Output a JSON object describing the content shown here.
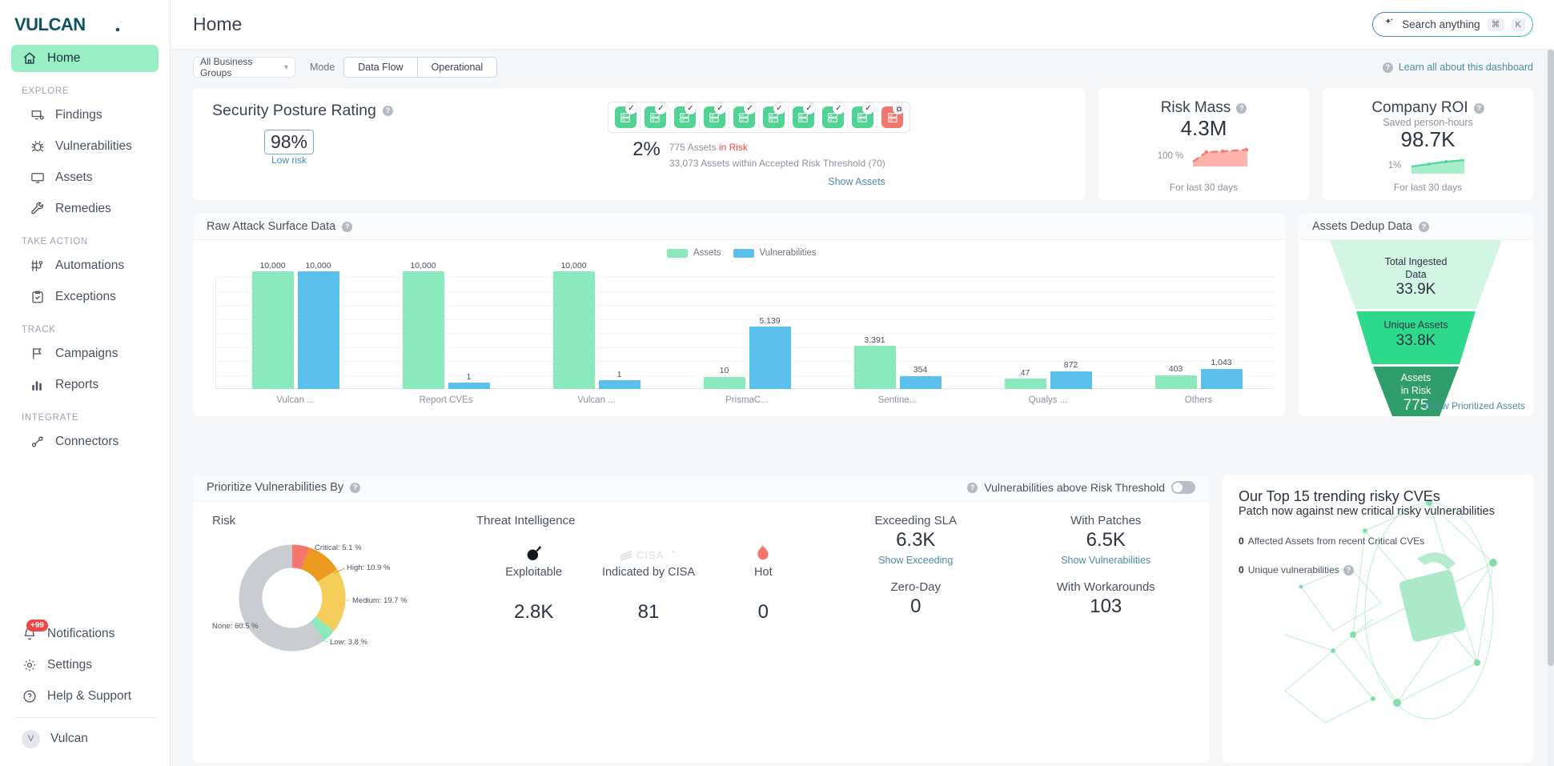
{
  "sidebar": {
    "logo_text": "VULCAN.",
    "home": {
      "label": "Home",
      "icon": "home-icon"
    },
    "sections": [
      {
        "title": "EXPLORE",
        "items": [
          {
            "label": "Findings",
            "icon": "findings-icon"
          },
          {
            "label": "Vulnerabilities",
            "icon": "bug-icon"
          },
          {
            "label": "Assets",
            "icon": "monitor-icon"
          },
          {
            "label": "Remedies",
            "icon": "wrench-icon"
          }
        ]
      },
      {
        "title": "TAKE ACTION",
        "items": [
          {
            "label": "Automations",
            "icon": "automations-icon"
          },
          {
            "label": "Exceptions",
            "icon": "clipboard-check-icon"
          }
        ]
      },
      {
        "title": "TRACK",
        "items": [
          {
            "label": "Campaigns",
            "icon": "flag-icon"
          },
          {
            "label": "Reports",
            "icon": "bar-chart-icon"
          }
        ]
      },
      {
        "title": "INTEGRATE",
        "items": [
          {
            "label": "Connectors",
            "icon": "connectors-icon"
          }
        ]
      }
    ],
    "bottom": [
      {
        "label": "Notifications",
        "icon": "bell-icon",
        "badge": "+99"
      },
      {
        "label": "Settings",
        "icon": "gear-icon"
      },
      {
        "label": "Help & Support",
        "icon": "help-circle-icon"
      }
    ],
    "account": {
      "label": "Vulcan",
      "initial": "V"
    }
  },
  "header": {
    "title": "Home",
    "search": {
      "placeholder": "Search anything",
      "kbd1": "⌘",
      "kbd2": "K",
      "icon": "sparkle-icon"
    }
  },
  "filters": {
    "business_group": "All Business Groups",
    "mode_label": "Mode",
    "mode_options": [
      "Data Flow",
      "Operational"
    ],
    "learn_link": "Learn all about this dashboard"
  },
  "security_posture": {
    "title": "Security Posture Rating",
    "rating": "98%",
    "risk_label": "Low risk",
    "at_risk_pct": "2%",
    "assets_in_risk_prefix": "775 Assets ",
    "assets_in_risk_suffix": "in Risk",
    "within_threshold": "33,073 Assets within Accepted Risk Threshold (70)",
    "show_assets": "Show Assets",
    "servers": [
      {
        "state": "ok"
      },
      {
        "state": "ok"
      },
      {
        "state": "ok"
      },
      {
        "state": "ok"
      },
      {
        "state": "ok"
      },
      {
        "state": "ok"
      },
      {
        "state": "ok"
      },
      {
        "state": "ok"
      },
      {
        "state": "ok"
      },
      {
        "state": "risk"
      }
    ]
  },
  "risk_mass": {
    "title": "Risk Mass",
    "value": "4.3M",
    "delta": "100 %",
    "footer": "For last 30 days",
    "color": "#f4776e"
  },
  "company_roi": {
    "title": "Company ROI",
    "subtitle": "Saved person-hours",
    "value": "98.7K",
    "delta": "1%",
    "footer": "For last 30 days",
    "color": "#8ae9bd"
  },
  "raw_attack_surface": {
    "title": "Raw Attack Surface Data"
  },
  "chart_data": {
    "type": "bar",
    "title": "Raw Attack Surface Data",
    "categories": [
      "Vulcan ...",
      "Report CVEs",
      "Vulcan ...",
      "PrismaC...",
      "Sentine...",
      "Qualys ...",
      "Others"
    ],
    "series": [
      {
        "name": "Assets",
        "color": "#8ae9bd",
        "values": [
          10000,
          10000,
          10000,
          10,
          3391,
          47,
          403
        ],
        "labels": [
          "10,000",
          "10,000",
          "10,000",
          "10",
          "3,391",
          "47",
          "403"
        ]
      },
      {
        "name": "Vulnerabilities",
        "color": "#5bc0ec",
        "values": [
          10000,
          1,
          1,
          5139,
          354,
          872,
          1043
        ],
        "labels": [
          "10,000",
          "1",
          "1",
          "5,139",
          "354",
          "872",
          "1,043"
        ]
      }
    ],
    "ylim": [
      0,
      10000
    ],
    "grid": true,
    "legend_position": "top-center",
    "xlabel": "",
    "ylabel": ""
  },
  "assets_dedup": {
    "title": "Assets Dedup Data",
    "show_link": "Show Prioritized Assets",
    "stages": [
      {
        "name": "Total Ingested\nData",
        "name_l1": "Total Ingested",
        "name_l2": "Data",
        "value": "33.9K",
        "color": "#d3f5e4"
      },
      {
        "name": "Unique Assets",
        "name_l1": "Unique Assets",
        "name_l2": "",
        "value": "33.8K",
        "color": "#2ed98b"
      },
      {
        "name": "Assets in Risk",
        "name_l1": "Assets",
        "name_l2": "in Risk",
        "value": "775",
        "color": "#2f9e6b"
      }
    ]
  },
  "prioritize": {
    "title": "Prioritize Vulnerabilities By",
    "threshold_toggle_label": "Vulnerabilities above Risk Threshold",
    "risk": {
      "heading": "Risk",
      "slices": [
        {
          "label": "Critical: 5.1 %",
          "value": 5.1,
          "color": "#f4776e"
        },
        {
          "label": "High: 10.9 %",
          "value": 10.9,
          "color": "#eb9a1e"
        },
        {
          "label": "Medium: 19.7 %",
          "value": 19.7,
          "color": "#f5ce5a"
        },
        {
          "label": "Low: 3.8 %",
          "value": 3.8,
          "color": "#8ae9bd"
        },
        {
          "label": "None: 60.5 %",
          "value": 60.5,
          "color": "#c9ccd1"
        }
      ]
    },
    "threat_intelligence": {
      "heading": "Threat Intelligence",
      "items": [
        {
          "name": "Exploitable",
          "value": "2.8K",
          "icon": "bomb-icon"
        },
        {
          "name": "Indicated by CISA",
          "value": "81",
          "icon": "cisa-icon"
        },
        {
          "name": "Hot",
          "value": "0",
          "icon": "flame-icon"
        }
      ]
    },
    "kpis": [
      {
        "title": "Exceeding SLA",
        "value": "6.3K",
        "link": "Show Exceeding"
      },
      {
        "title": "With Patches",
        "value": "6.5K",
        "link": "Show Vulnerabilities"
      },
      {
        "title": "Zero-Day",
        "value": "0",
        "link": ""
      },
      {
        "title": "With Workarounds",
        "value": "103",
        "link": ""
      }
    ]
  },
  "trending_cves": {
    "title": "Our Top 15 trending risky CVEs",
    "subtitle": "Patch now against new critical risky vulnerabilities",
    "stat1_num": "0",
    "stat1_text": "Affected Assets from recent Critical CVEs",
    "stat2_num": "0",
    "stat2_text": "Unique vulnerabilities"
  }
}
